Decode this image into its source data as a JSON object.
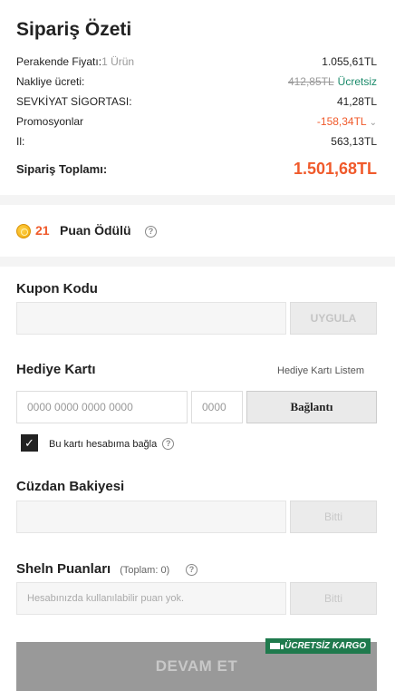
{
  "summary": {
    "title": "Sipariş Özeti",
    "retail": {
      "label": "Perakende Fiyatı:",
      "sub": "1 Ürün",
      "value": "1.055,61TL"
    },
    "shipping": {
      "label": "Nakliye ücreti:",
      "old": "412,85TL",
      "value": "Ücretsiz"
    },
    "insurance": {
      "label": "SEVKİYAT SİGORTASI:",
      "value": "41,28TL"
    },
    "promotions": {
      "label": "Promosyonlar",
      "value": "-158,34TL"
    },
    "tax": {
      "label": "Il:",
      "value": "563,13TL"
    },
    "total": {
      "label": "Sipariş Toplamı:",
      "value": "1.501,68TL"
    }
  },
  "reward": {
    "points": "21",
    "label": "Puan Ödülü"
  },
  "coupon": {
    "title": "Kupon Kodu",
    "placeholder": "",
    "apply": "UYGULA"
  },
  "giftcard": {
    "title": "Hediye Kartı",
    "list_link": "Hediye Kartı Listem",
    "number_placeholder": "0000 0000 0000 0000",
    "pin_placeholder": "0000",
    "connect": "Bağlantı",
    "bind_label": "Bu kartı hesabıma bağla",
    "bind_checked": true
  },
  "wallet": {
    "title": "Cüzdan Bakiyesi",
    "placeholder": "",
    "apply": "Bitti"
  },
  "points": {
    "title": "Sheln Puanları",
    "total": "(Toplam: 0)",
    "placeholder": "Hesabınızda kullanılabilir puan yok.",
    "apply": "Bitti"
  },
  "checkout": {
    "continue": "DEVAM ET",
    "badge": "ÜCRETSİZ KARGO"
  },
  "colors": {
    "accent": "#f05a2b",
    "free": "#1a8a6a",
    "badge": "#1f7a4d"
  },
  "icons": {
    "coin": "coin-icon",
    "help": "help-icon",
    "chevron": "chevron-down-icon",
    "truck": "truck-icon",
    "check": "check-icon"
  }
}
